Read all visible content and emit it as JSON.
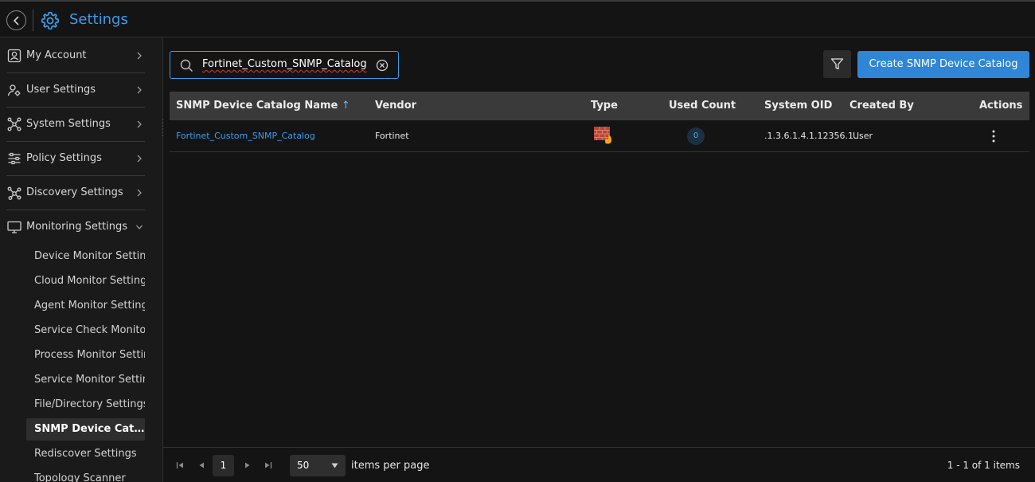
{
  "header": {
    "title": "Settings",
    "back_icon": "chevron-left-icon",
    "title_icon": "gear-icon"
  },
  "sidebar": {
    "items": [
      {
        "label": "My Account",
        "icon": "user-card-icon"
      },
      {
        "label": "User Settings",
        "icon": "user-gear-icon"
      },
      {
        "label": "System Settings",
        "icon": "network-nodes-icon"
      },
      {
        "label": "Policy Settings",
        "icon": "sliders-icon"
      },
      {
        "label": "Discovery Settings",
        "icon": "discovery-nodes-icon"
      },
      {
        "label": "Monitoring Settings",
        "icon": "monitor-icon"
      }
    ],
    "sub_items": [
      "Device Monitor Settings",
      "Cloud Monitor Settings",
      "Agent Monitor Settings",
      "Service Check Monitor",
      "Process Monitor Settings",
      "Service Monitor Settings",
      "File/Directory Settings",
      "SNMP Device Catalog",
      "Rediscover Settings",
      "Topology Scanner"
    ],
    "active_sub_item": "SNMP Device Catalog"
  },
  "search": {
    "value": "Fortinet_Custom_SNMP_Catalog"
  },
  "toolbar": {
    "filter_icon": "filter-icon",
    "create_label": "Create SNMP Device Catalog"
  },
  "table": {
    "columns": [
      "SNMP Device Catalog Name",
      "Vendor",
      "Type",
      "Used Count",
      "System OID",
      "Created By",
      "Actions"
    ],
    "sort_indicator": "↑",
    "rows": [
      {
        "name": "Fortinet_Custom_SNMP_Catalog",
        "vendor": "Fortinet",
        "type_icon": "firewall-icon",
        "used_count": "0",
        "system_oid": ".1.3.6.1.4.1.12356.1...",
        "created_by": "User"
      }
    ]
  },
  "pagination": {
    "current_page": "1",
    "page_size": "50",
    "items_per_page_label": "items per page",
    "range": "1 - 1 of 1 items"
  },
  "colors": {
    "accent": "#3d9be9",
    "primary_button": "#2f86d6",
    "background": "#141414"
  }
}
